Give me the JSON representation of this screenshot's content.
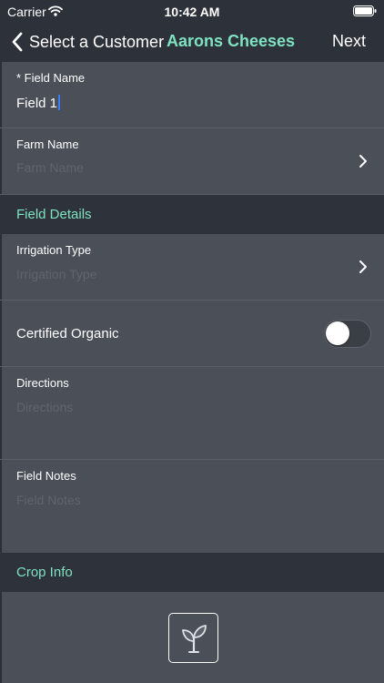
{
  "status_bar": {
    "carrier": "Carrier",
    "wifi_icon": "wifi-icon",
    "time": "10:42 AM",
    "battery_icon": "battery-icon"
  },
  "nav": {
    "back_label": "Select a Customer",
    "back_icon": "chevron-left-icon",
    "title": "Aarons Cheeses",
    "next_label": "Next"
  },
  "form": {
    "field_name": {
      "label": "* Field Name",
      "value": "Field 1"
    },
    "farm_name": {
      "label": "Farm Name",
      "placeholder": "Farm Name"
    },
    "field_details": {
      "section_title": "Field Details"
    },
    "irrigation_type": {
      "label": "Irrigation Type",
      "placeholder": "Irrigation Type"
    },
    "certified_organic": {
      "label": "Certified Organic",
      "on": false
    },
    "directions": {
      "label": "Directions",
      "placeholder": "Directions"
    },
    "field_notes": {
      "label": "Field Notes",
      "placeholder": "Field Notes"
    },
    "crop_info": {
      "section_title": "Crop Info",
      "add_crop_icon": "plant-sprout-icon"
    }
  },
  "colors": {
    "background": "#4a4f58",
    "header": "#2d3139",
    "section": "#2e323a",
    "accent": "#7fe3c2",
    "placeholder": "#5f646d",
    "cursor": "#3a7bf7"
  }
}
